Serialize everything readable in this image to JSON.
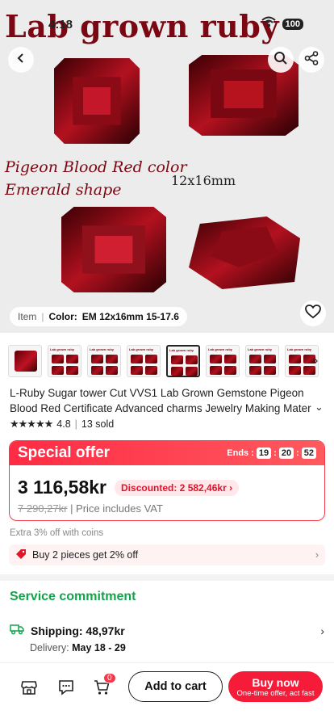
{
  "status_bar": {
    "time": "4:18",
    "battery": "100"
  },
  "hero": {
    "title": "Lab grown ruby",
    "subtitle_line1": "Pigeon Blood Red color",
    "subtitle_line2": "Emerald shape",
    "size_label": "12x16mm",
    "variant_label": "Item",
    "variant_prefix": "Color:",
    "variant_value": "EM 12x16mm 15-17.6"
  },
  "thumbnails": {
    "count": 8,
    "active_index": 4,
    "thumb_text": "Lab grown ruby"
  },
  "product": {
    "title_line1": "L-Ruby Sugar tower Cut VVS1 Lab Grown Gemstone Pigeon",
    "title_line2": "Blood Red Certificate Advanced charms Jewelry Making Mater",
    "stars": "★★★★★",
    "rating": "4.8",
    "sold": "13 sold"
  },
  "offer": {
    "title": "Special offer",
    "ends_label": "Ends :",
    "timer_h": "19",
    "timer_m": "20",
    "timer_s": "52",
    "price": "3 116,58kr",
    "discount": "Discounted: 2 582,46kr ›",
    "original_price": "7 290,27kr",
    "vat_note": "| Price includes VAT"
  },
  "coins_text": "Extra 3% off with coins",
  "promo_text": "Buy 2 pieces get 2% off",
  "service": {
    "title": "Service commitment",
    "shipping_label": "Shipping: 48,97kr",
    "delivery_prefix": "Delivery:",
    "delivery_dates": "May 18 - 29"
  },
  "bottom_bar": {
    "cart_badge": "0",
    "add_to_cart": "Add to cart",
    "buy_now": "Buy now",
    "buy_now_sub": "One-time offer, act fast"
  },
  "colors": {
    "accent_red": "#f23b4a",
    "service_green": "#12a44a",
    "ruby": "#7a0712"
  }
}
